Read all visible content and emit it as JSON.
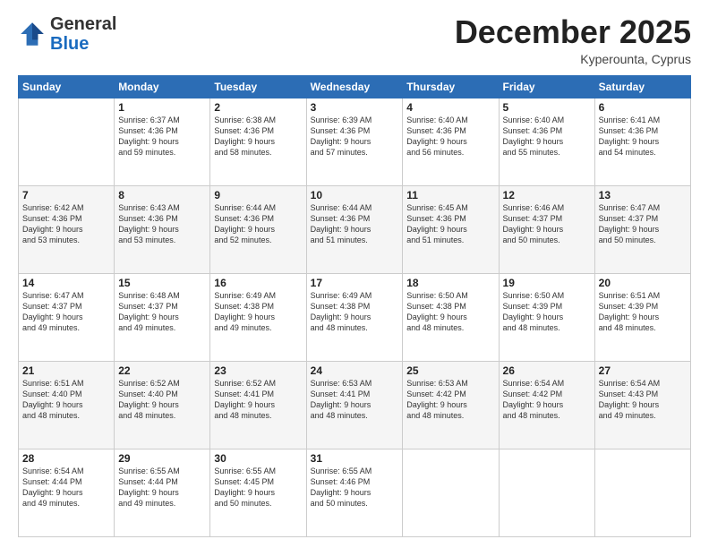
{
  "logo": {
    "general": "General",
    "blue": "Blue"
  },
  "header": {
    "month": "December 2025",
    "location": "Kyperounta, Cyprus"
  },
  "weekdays": [
    "Sunday",
    "Monday",
    "Tuesday",
    "Wednesday",
    "Thursday",
    "Friday",
    "Saturday"
  ],
  "weeks": [
    [
      {
        "day": "",
        "sunrise": "",
        "sunset": "",
        "daylight": ""
      },
      {
        "day": "1",
        "sunrise": "Sunrise: 6:37 AM",
        "sunset": "Sunset: 4:36 PM",
        "daylight": "Daylight: 9 hours and 59 minutes."
      },
      {
        "day": "2",
        "sunrise": "Sunrise: 6:38 AM",
        "sunset": "Sunset: 4:36 PM",
        "daylight": "Daylight: 9 hours and 58 minutes."
      },
      {
        "day": "3",
        "sunrise": "Sunrise: 6:39 AM",
        "sunset": "Sunset: 4:36 PM",
        "daylight": "Daylight: 9 hours and 57 minutes."
      },
      {
        "day": "4",
        "sunrise": "Sunrise: 6:40 AM",
        "sunset": "Sunset: 4:36 PM",
        "daylight": "Daylight: 9 hours and 56 minutes."
      },
      {
        "day": "5",
        "sunrise": "Sunrise: 6:40 AM",
        "sunset": "Sunset: 4:36 PM",
        "daylight": "Daylight: 9 hours and 55 minutes."
      },
      {
        "day": "6",
        "sunrise": "Sunrise: 6:41 AM",
        "sunset": "Sunset: 4:36 PM",
        "daylight": "Daylight: 9 hours and 54 minutes."
      }
    ],
    [
      {
        "day": "7",
        "sunrise": "Sunrise: 6:42 AM",
        "sunset": "Sunset: 4:36 PM",
        "daylight": "Daylight: 9 hours and 53 minutes."
      },
      {
        "day": "8",
        "sunrise": "Sunrise: 6:43 AM",
        "sunset": "Sunset: 4:36 PM",
        "daylight": "Daylight: 9 hours and 53 minutes."
      },
      {
        "day": "9",
        "sunrise": "Sunrise: 6:44 AM",
        "sunset": "Sunset: 4:36 PM",
        "daylight": "Daylight: 9 hours and 52 minutes."
      },
      {
        "day": "10",
        "sunrise": "Sunrise: 6:44 AM",
        "sunset": "Sunset: 4:36 PM",
        "daylight": "Daylight: 9 hours and 51 minutes."
      },
      {
        "day": "11",
        "sunrise": "Sunrise: 6:45 AM",
        "sunset": "Sunset: 4:36 PM",
        "daylight": "Daylight: 9 hours and 51 minutes."
      },
      {
        "day": "12",
        "sunrise": "Sunrise: 6:46 AM",
        "sunset": "Sunset: 4:37 PM",
        "daylight": "Daylight: 9 hours and 50 minutes."
      },
      {
        "day": "13",
        "sunrise": "Sunrise: 6:47 AM",
        "sunset": "Sunset: 4:37 PM",
        "daylight": "Daylight: 9 hours and 50 minutes."
      }
    ],
    [
      {
        "day": "14",
        "sunrise": "Sunrise: 6:47 AM",
        "sunset": "Sunset: 4:37 PM",
        "daylight": "Daylight: 9 hours and 49 minutes."
      },
      {
        "day": "15",
        "sunrise": "Sunrise: 6:48 AM",
        "sunset": "Sunset: 4:37 PM",
        "daylight": "Daylight: 9 hours and 49 minutes."
      },
      {
        "day": "16",
        "sunrise": "Sunrise: 6:49 AM",
        "sunset": "Sunset: 4:38 PM",
        "daylight": "Daylight: 9 hours and 49 minutes."
      },
      {
        "day": "17",
        "sunrise": "Sunrise: 6:49 AM",
        "sunset": "Sunset: 4:38 PM",
        "daylight": "Daylight: 9 hours and 48 minutes."
      },
      {
        "day": "18",
        "sunrise": "Sunrise: 6:50 AM",
        "sunset": "Sunset: 4:38 PM",
        "daylight": "Daylight: 9 hours and 48 minutes."
      },
      {
        "day": "19",
        "sunrise": "Sunrise: 6:50 AM",
        "sunset": "Sunset: 4:39 PM",
        "daylight": "Daylight: 9 hours and 48 minutes."
      },
      {
        "day": "20",
        "sunrise": "Sunrise: 6:51 AM",
        "sunset": "Sunset: 4:39 PM",
        "daylight": "Daylight: 9 hours and 48 minutes."
      }
    ],
    [
      {
        "day": "21",
        "sunrise": "Sunrise: 6:51 AM",
        "sunset": "Sunset: 4:40 PM",
        "daylight": "Daylight: 9 hours and 48 minutes."
      },
      {
        "day": "22",
        "sunrise": "Sunrise: 6:52 AM",
        "sunset": "Sunset: 4:40 PM",
        "daylight": "Daylight: 9 hours and 48 minutes."
      },
      {
        "day": "23",
        "sunrise": "Sunrise: 6:52 AM",
        "sunset": "Sunset: 4:41 PM",
        "daylight": "Daylight: 9 hours and 48 minutes."
      },
      {
        "day": "24",
        "sunrise": "Sunrise: 6:53 AM",
        "sunset": "Sunset: 4:41 PM",
        "daylight": "Daylight: 9 hours and 48 minutes."
      },
      {
        "day": "25",
        "sunrise": "Sunrise: 6:53 AM",
        "sunset": "Sunset: 4:42 PM",
        "daylight": "Daylight: 9 hours and 48 minutes."
      },
      {
        "day": "26",
        "sunrise": "Sunrise: 6:54 AM",
        "sunset": "Sunset: 4:42 PM",
        "daylight": "Daylight: 9 hours and 48 minutes."
      },
      {
        "day": "27",
        "sunrise": "Sunrise: 6:54 AM",
        "sunset": "Sunset: 4:43 PM",
        "daylight": "Daylight: 9 hours and 49 minutes."
      }
    ],
    [
      {
        "day": "28",
        "sunrise": "Sunrise: 6:54 AM",
        "sunset": "Sunset: 4:44 PM",
        "daylight": "Daylight: 9 hours and 49 minutes."
      },
      {
        "day": "29",
        "sunrise": "Sunrise: 6:55 AM",
        "sunset": "Sunset: 4:44 PM",
        "daylight": "Daylight: 9 hours and 49 minutes."
      },
      {
        "day": "30",
        "sunrise": "Sunrise: 6:55 AM",
        "sunset": "Sunset: 4:45 PM",
        "daylight": "Daylight: 9 hours and 50 minutes."
      },
      {
        "day": "31",
        "sunrise": "Sunrise: 6:55 AM",
        "sunset": "Sunset: 4:46 PM",
        "daylight": "Daylight: 9 hours and 50 minutes."
      },
      {
        "day": "",
        "sunrise": "",
        "sunset": "",
        "daylight": ""
      },
      {
        "day": "",
        "sunrise": "",
        "sunset": "",
        "daylight": ""
      },
      {
        "day": "",
        "sunrise": "",
        "sunset": "",
        "daylight": ""
      }
    ]
  ]
}
